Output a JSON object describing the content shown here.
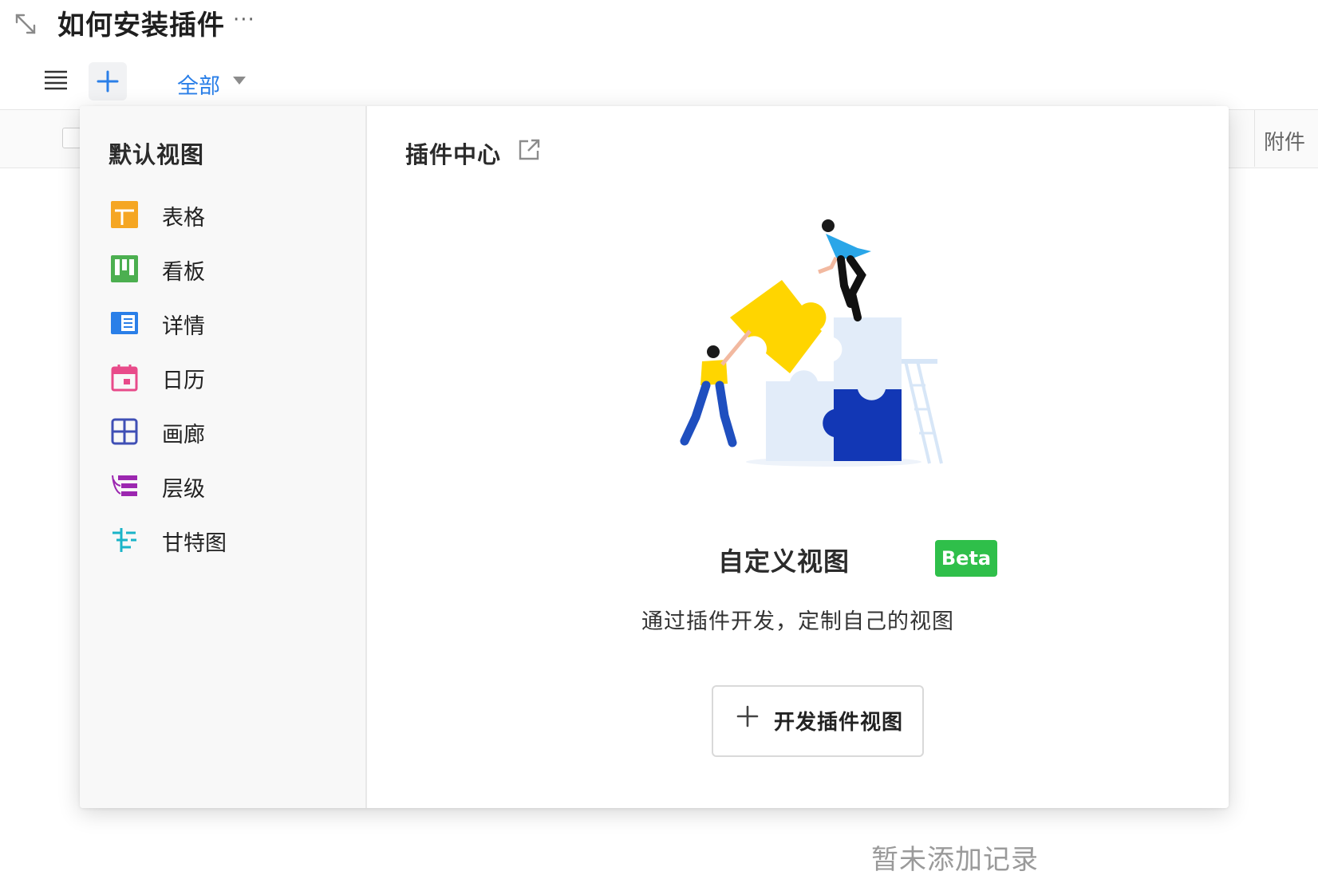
{
  "header": {
    "title": "如何安装插件",
    "more": "···",
    "expand_icon": "expand-diagonal-icon",
    "menu_icon": "hamburger-menu-icon",
    "add_icon": "plus-icon"
  },
  "view_tab": {
    "label": "全部",
    "active_color": "#2a7fe8"
  },
  "table": {
    "column_attachment": "附件",
    "empty_message": "暂未添加记录"
  },
  "panel": {
    "default_views_title": "默认视图",
    "default_views": [
      {
        "label": "表格",
        "icon": "table-grid-icon",
        "color": "#f5a623"
      },
      {
        "label": "看板",
        "icon": "kanban-icon",
        "color": "#4caf50"
      },
      {
        "label": "详情",
        "icon": "detail-icon",
        "color": "#2a7fe8"
      },
      {
        "label": "日历",
        "icon": "calendar-icon",
        "color": "#e84b8a"
      },
      {
        "label": "画廊",
        "icon": "gallery-icon",
        "color": "#3f4fb5"
      },
      {
        "label": "层级",
        "icon": "hierarchy-icon",
        "color": "#9c27b0"
      },
      {
        "label": "甘特图",
        "icon": "gantt-icon",
        "color": "#1ab4c8"
      }
    ],
    "plugin_center_title": "插件中心",
    "external_link_icon": "external-link-icon",
    "illustration": "puzzle-team-illustration",
    "custom_view_title": "自定义视图",
    "beta_label": "Beta",
    "beta_color": "#2fbf4a",
    "description": "通过插件开发，定制自己的视图",
    "develop_button_label": "开发插件视图"
  }
}
